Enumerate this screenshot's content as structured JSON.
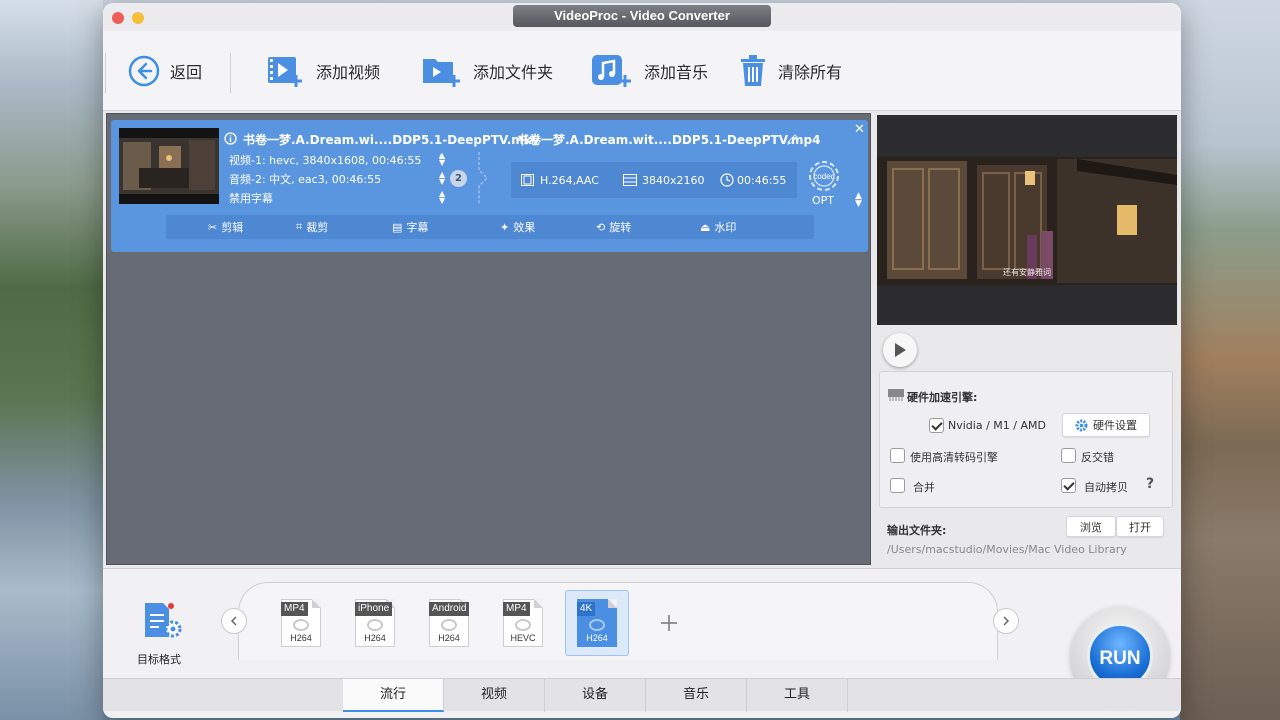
{
  "window": {
    "title": "VideoProc - Video Converter"
  },
  "toolbar": {
    "back": "返回",
    "add_video": "添加视频",
    "add_folder": "添加文件夹",
    "add_music": "添加音乐",
    "clear_all": "清除所有"
  },
  "file": {
    "source_name": "书卷一梦.A.Dream.wi....DDP5.1-DeepPTV.mkv",
    "video_track": "视频-1: hevc, 3840x1608, 00:46:55",
    "audio_track": "音频-2: 中文, eac3, 00:46:55",
    "subtitle": "禁用字幕",
    "audio_count": "2",
    "output_name": "书卷一梦.A.Dream.wit....DDP5.1-DeepPTV.mp4",
    "out_codec": "H.264,AAC",
    "out_resolution": "3840x2160",
    "out_duration": "00:46:55",
    "codec_label": "codec",
    "opt_label": "OPT"
  },
  "edit_bar": {
    "cut": "剪辑",
    "crop": "裁剪",
    "subtitle": "字幕",
    "effects": "效果",
    "rotate": "旋转",
    "watermark": "水印"
  },
  "preview": {
    "caption": "还有安静雅词"
  },
  "settings": {
    "hw_accel_title": "硬件加速引擎:",
    "nvidia_label": "Nvidia /  M1 / AMD",
    "nvidia_checked": true,
    "hw_settings": "硬件设置",
    "hq_engine": "使用高清转码引擎",
    "hq_checked": false,
    "deinterlace": "反交错",
    "deinterlace_checked": false,
    "merge": "合并",
    "merge_checked": false,
    "auto_copy": "自动拷贝",
    "auto_copy_checked": true,
    "help": "?"
  },
  "output": {
    "label": "输出文件夹:",
    "browse": "浏览",
    "open": "打开",
    "path": "/Users/macstudio/Movies/Mac Video Library"
  },
  "formats": {
    "target_label": "目标格式",
    "items": [
      {
        "tag": "MP4",
        "codec": "H264",
        "selected": false
      },
      {
        "tag": "iPhone",
        "codec": "H264",
        "selected": false
      },
      {
        "tag": "Android",
        "codec": "H264",
        "selected": false
      },
      {
        "tag": "MP4",
        "codec": "HEVC",
        "selected": false
      },
      {
        "tag": "4K",
        "codec": "H264",
        "selected": true
      }
    ]
  },
  "tabs": [
    "流行",
    "视频",
    "设备",
    "音乐",
    "工具"
  ],
  "run": "RUN",
  "colors": {
    "accent": "#3d8ee6",
    "card": "#5a96e0",
    "run": "#1b6fd6"
  }
}
